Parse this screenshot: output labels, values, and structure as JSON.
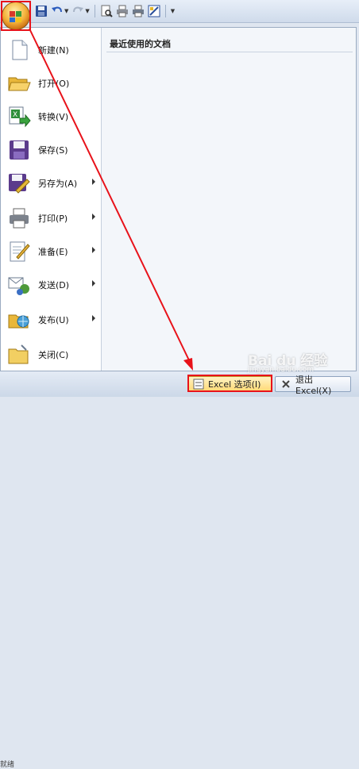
{
  "quick_access": {
    "save_icon": "save-icon",
    "undo_icon": "undo-icon",
    "redo_icon": "redo-icon",
    "print_preview_icon": "print-preview-icon",
    "quick_print_icon": "quick-print-icon",
    "customize_icon": "customize-dropdown-icon"
  },
  "menu": {
    "items": [
      {
        "label": "新建(N)",
        "icon": "new-document-icon",
        "submenu": false
      },
      {
        "label": "打开(O)",
        "icon": "open-folder-icon",
        "submenu": false
      },
      {
        "label": "转换(V)",
        "icon": "convert-icon",
        "submenu": false
      },
      {
        "label": "保存(S)",
        "icon": "save-icon",
        "submenu": false
      },
      {
        "label": "另存为(A)",
        "icon": "save-as-icon",
        "submenu": true
      },
      {
        "label": "打印(P)",
        "icon": "printer-icon",
        "submenu": true
      },
      {
        "label": "准备(E)",
        "icon": "prepare-icon",
        "submenu": true
      },
      {
        "label": "发送(D)",
        "icon": "send-icon",
        "submenu": true
      },
      {
        "label": "发布(U)",
        "icon": "publish-icon",
        "submenu": true
      },
      {
        "label": "关闭(C)",
        "icon": "close-folder-icon",
        "submenu": false
      }
    ],
    "recent_title": "最近使用的文档"
  },
  "footer": {
    "options_label": "Excel 选项(I)",
    "exit_label": "退出 Excel(X)"
  },
  "background": {
    "partial_text": "就绪"
  },
  "watermark": {
    "brand": "Bai du 经验",
    "url": "jingyan.baidu.com"
  },
  "colors": {
    "highlight": "#e8121a",
    "options_button": "#ffd873"
  }
}
